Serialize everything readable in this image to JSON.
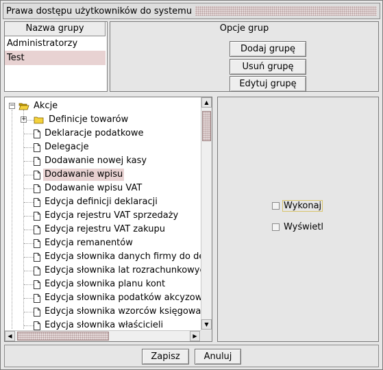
{
  "window": {
    "title": "Prawa dostępu użytkowników do systemu"
  },
  "groups": {
    "header": "Nazwa grupy",
    "items": [
      {
        "name": "Administratorzy",
        "selected": false
      },
      {
        "name": "Test",
        "selected": true
      }
    ]
  },
  "options": {
    "title": "Opcje grup",
    "add_label": "Dodaj grupę",
    "remove_label": "Usuń grupę",
    "edit_label": "Edytuj grupę"
  },
  "tree": {
    "root": {
      "label": "Akcje",
      "expanded": true,
      "icon": "open-folder-icon"
    },
    "folder": {
      "label": "Definicje towarów",
      "expanded": false,
      "icon": "folder-icon"
    },
    "items": [
      {
        "label": "Deklaracje podatkowe",
        "selected": false
      },
      {
        "label": "Delegacje",
        "selected": false
      },
      {
        "label": "Dodawanie nowej kasy",
        "selected": false
      },
      {
        "label": "Dodawanie wpisu",
        "selected": true
      },
      {
        "label": "Dodawanie wpisu VAT",
        "selected": false
      },
      {
        "label": "Edycja definicji deklaracji",
        "selected": false
      },
      {
        "label": "Edycja rejestru VAT sprzedaży",
        "selected": false
      },
      {
        "label": "Edycja rejestru VAT zakupu",
        "selected": false
      },
      {
        "label": "Edycja remanentów",
        "selected": false
      },
      {
        "label": "Edycja słownika danych firmy do deklaracji",
        "selected": false
      },
      {
        "label": "Edycja słownika lat rozrachunkowych",
        "selected": false
      },
      {
        "label": "Edycja słownika planu kont",
        "selected": false
      },
      {
        "label": "Edycja słownika podatków akcyzowych",
        "selected": false
      },
      {
        "label": "Edycja słownika wzorców księgowania",
        "selected": false
      },
      {
        "label": "Edycja słownika właścicieli",
        "selected": false
      }
    ]
  },
  "permissions": {
    "execute_label": "Wykonaj",
    "execute_checked": false,
    "display_label": "Wyświetl",
    "display_checked": false
  },
  "footer": {
    "save_label": "Zapisz",
    "cancel_label": "Anuluj"
  },
  "colors": {
    "background": "#e6e6e6",
    "selection": "#e8d2d2",
    "border": "#7a7a7a"
  }
}
